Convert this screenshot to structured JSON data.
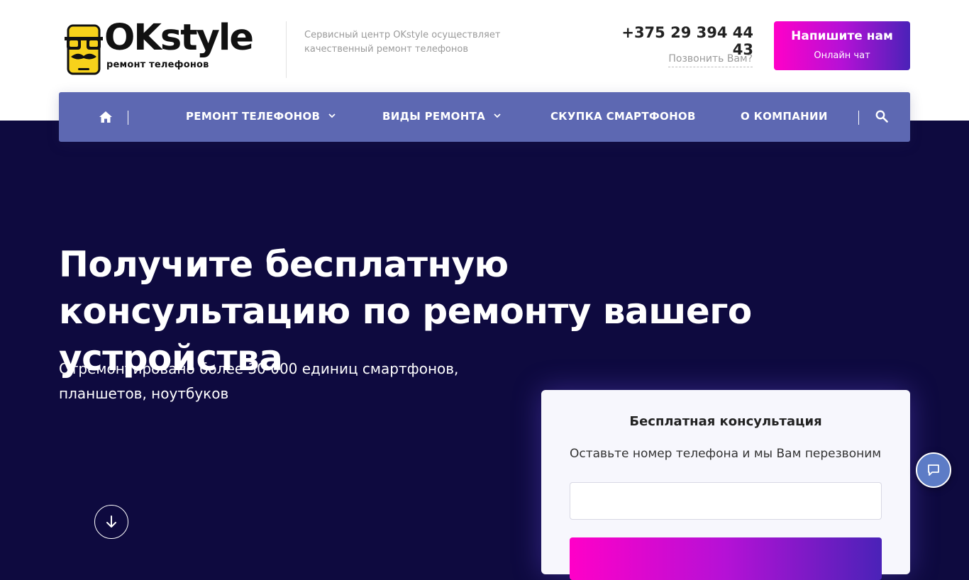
{
  "brand": {
    "logo_text": "OKstyle",
    "logo_subtitle": "ремонт телефонов",
    "tagline": "Сервисный центр OKstyle осуществляет качественный ремонт телефонов"
  },
  "contacts": {
    "phone": "+375 29 394 44 43",
    "callback_label": "Позвонить Вам?"
  },
  "chat_button": {
    "title": "Напишите нам",
    "subtitle": "Онлайн чат"
  },
  "nav": {
    "items": [
      {
        "label": "РЕМОНТ ТЕЛЕФОНОВ",
        "has_dropdown": true
      },
      {
        "label": "ВИДЫ РЕМОНТА",
        "has_dropdown": true
      },
      {
        "label": "СКУПКА СМАРТФОНОВ",
        "has_dropdown": false
      },
      {
        "label": "О КОМПАНИИ",
        "has_dropdown": false
      }
    ],
    "home_icon": "home-icon",
    "search_icon": "search-icon"
  },
  "hero": {
    "title": "Получите бесплатную консультацию по ремонту вашего устройства",
    "subtitle": "Отремонтировано более 30 000 единиц смартфонов, планшетов, ноутбуков",
    "scroll_icon": "arrow-down-icon"
  },
  "consult_form": {
    "title": "Бесплатная консультация",
    "description": "Оставьте номер телефона и мы Вам перезвоним",
    "phone_value": ""
  },
  "colors": {
    "hero_background": "#0e0a3f",
    "nav_background": "#5d68b2",
    "accent_gradient_start": "#ff00c8",
    "accent_gradient_end": "#4a22b8",
    "chat_fab": "#5d7cc6"
  }
}
